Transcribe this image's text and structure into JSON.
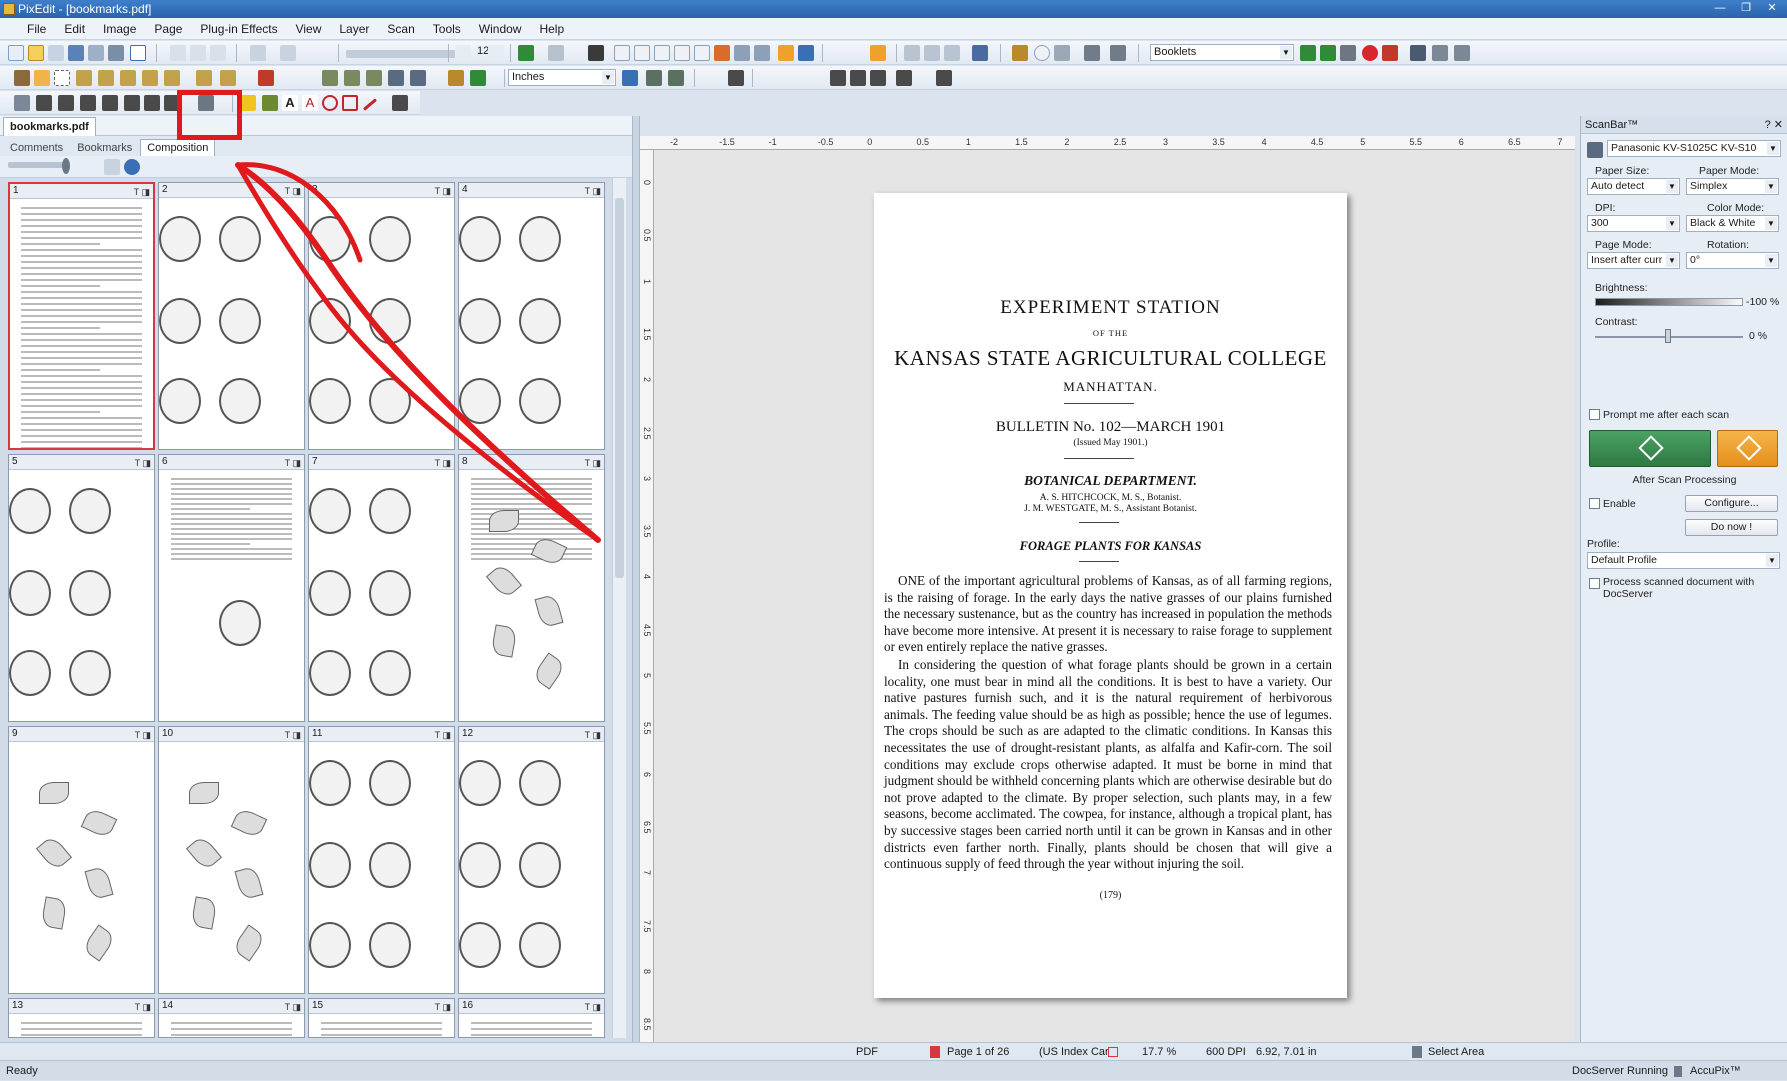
{
  "window": {
    "title": "PixEdit - [bookmarks.pdf]",
    "buttons": [
      "—",
      "❐",
      "✕"
    ]
  },
  "menu": [
    "File",
    "Edit",
    "Image",
    "Page",
    "Plug-in Effects",
    "View",
    "Layer",
    "Scan",
    "Tools",
    "Window",
    "Help"
  ],
  "toolbar": {
    "page_number": "12",
    "units": "Inches",
    "workflow": "Booklets"
  },
  "document_tab": "bookmarks.pdf",
  "side_tabs": [
    "Comments",
    "Bookmarks",
    "Composition"
  ],
  "thumbnails": [
    {
      "n": "1",
      "kind": "text"
    },
    {
      "n": "2",
      "kind": "fruit"
    },
    {
      "n": "3",
      "kind": "fruit"
    },
    {
      "n": "4",
      "kind": "fruit"
    },
    {
      "n": "5",
      "kind": "fruit"
    },
    {
      "n": "6",
      "kind": "textfruit"
    },
    {
      "n": "7",
      "kind": "fruit"
    },
    {
      "n": "8",
      "kind": "textplant"
    },
    {
      "n": "9",
      "kind": "plant"
    },
    {
      "n": "10",
      "kind": "plant"
    },
    {
      "n": "11",
      "kind": "fruit"
    },
    {
      "n": "12",
      "kind": "fruit"
    },
    {
      "n": "13",
      "kind": "text"
    },
    {
      "n": "14",
      "kind": "text"
    },
    {
      "n": "15",
      "kind": "text"
    },
    {
      "n": "16",
      "kind": "text"
    }
  ],
  "ruler": {
    "h": [
      "-2",
      "-1.5",
      "-1",
      "-0.5",
      "0",
      "0.5",
      "1",
      "1.5",
      "2",
      "2.5",
      "3",
      "3.5",
      "4",
      "4.5",
      "5",
      "5.5",
      "6",
      "6.5",
      "7"
    ],
    "v": [
      "0",
      "0.5",
      "1",
      "1.5",
      "2",
      "2.5",
      "3",
      "3.5",
      "4",
      "4.5",
      "5",
      "5.5",
      "6",
      "6.5",
      "7",
      "7.5",
      "8",
      "8.5"
    ]
  },
  "page": {
    "heading1": "EXPERIMENT STATION",
    "of_the": "OF THE",
    "college": "KANSAS STATE AGRICULTURAL COLLEGE",
    "city": "MANHATTAN.",
    "bulletin": "BULLETIN No. 102—MARCH 1901",
    "issued": "(Issued May 1901.)",
    "dept": "BOTANICAL DEPARTMENT.",
    "staff1": "A. S. HITCHCOCK, M. S., Botanist.",
    "staff2": "J. M. WESTGATE, M. S., Assistant Botanist.",
    "subject": "FORAGE PLANTS FOR KANSAS",
    "para1": "ONE of the important agricultural problems of Kansas, as of all farming regions, is the raising of forage. In the early days the native grasses of our plains furnished the necessary sustenance, but as the country has increased in population the methods have become more intensive. At present it is necessary to raise forage to supplement or even entirely replace the native grasses.",
    "para2": "In considering the question of what forage plants should be grown in a certain locality, one must bear in mind all the conditions. It is best to have a variety. Our native pastures furnish such, and it is the natural requirement of herbivorous animals. The feeding value should be as high as possible; hence the use of legumes. The crops should be such as are adapted to the climatic conditions. In Kansas this necessitates the use of drought-resistant plants, as alfalfa and Kafir-corn. The soil conditions may exclude crops otherwise adapted. It must be borne in mind that judgment should be withheld concerning plants which are otherwise desirable but do not prove adapted to the climate. By proper selection, such plants may, in a few seasons, become acclimated. The cowpea, for instance, although a tropical plant, has by successive stages been carried north until it can be grown in Kansas and in other districts even farther north. Finally, plants should be chosen that will give a continuous supply of feed through the year without injuring the soil.",
    "folio": "(179)"
  },
  "scanbar": {
    "title": "ScanBar™",
    "scanner": "Panasonic KV-S1025C KV-S10",
    "paper_size_label": "Paper Size:",
    "paper_size": "Auto detect",
    "paper_mode_label": "Paper Mode:",
    "paper_mode": "Simplex",
    "dpi_label": "DPI:",
    "dpi": "300",
    "color_mode_label": "Color Mode:",
    "color_mode": "Black & White",
    "page_mode_label": "Page Mode:",
    "page_mode": "Insert after curr",
    "rotation_label": "Rotation:",
    "rotation": "0°",
    "brightness_label": "Brightness:",
    "brightness": "-100 %",
    "contrast_label": "Contrast:",
    "contrast": "0 %",
    "prompt_label": "Prompt me after each scan",
    "after_scan": "After Scan Processing",
    "enable": "Enable",
    "configure": "Configure...",
    "do_now": "Do now !",
    "profile_label": "Profile:",
    "profile": "Default Profile",
    "docserver": "Process scanned document with DocServer"
  },
  "status": {
    "format": "PDF",
    "page": "Page 1 of 26",
    "paper": "(US Index Car",
    "zoom": "17.7 %",
    "dpi": "600 DPI",
    "coords": "6.92, 7.01 in",
    "tool": "Select Area"
  },
  "footer": {
    "ready": "Ready",
    "docserver": "DocServer Running",
    "brand": "AccuPix™"
  },
  "colors": {
    "accent": "#2a63ad",
    "highlight": "#e0191d",
    "scan_green": "#3a8a4f",
    "scan_orange": "#f0a12c"
  }
}
